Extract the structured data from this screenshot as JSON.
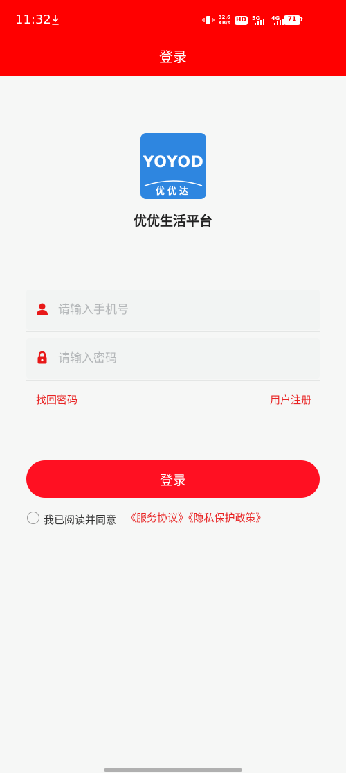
{
  "status_bar": {
    "time": "11:32",
    "speed": "32.6",
    "speed_unit": "KB/s",
    "hd": "HD",
    "net1": "5G",
    "net2": "4G",
    "battery": "71"
  },
  "header": {
    "title": "登录"
  },
  "logo": {
    "text": "YOYOD",
    "sub": "优优达"
  },
  "app_name": "优优生活平台",
  "form": {
    "phone_placeholder": "请输入手机号",
    "password_placeholder": "请输入密码"
  },
  "links": {
    "forgot": "找回密码",
    "register": "用户注册"
  },
  "login_button": "登录",
  "agreement": {
    "text": "我已阅读并同意",
    "links": "《服务协议》《隐私保护政策》"
  },
  "colors": {
    "brand": "#ff0000",
    "button": "#ff1022",
    "link": "#e82323",
    "logo_bg": "#2e86e0"
  }
}
